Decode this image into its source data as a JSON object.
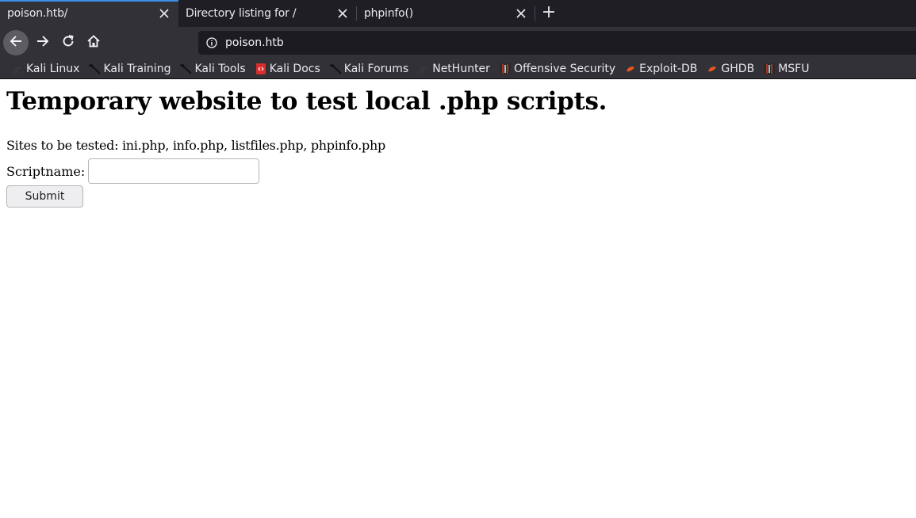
{
  "browser": {
    "tabs": [
      {
        "title": "poison.htb/",
        "active": true
      },
      {
        "title": "Directory listing for /",
        "active": false
      },
      {
        "title": "phpinfo()",
        "active": false
      }
    ],
    "url": "poison.htb",
    "bookmarks": [
      {
        "label": "Kali Linux",
        "icon": "kali-dragon-icon"
      },
      {
        "label": "Kali Training",
        "icon": "kali-dragon-icon"
      },
      {
        "label": "Kali Tools",
        "icon": "kali-dragon-icon"
      },
      {
        "label": "Kali Docs",
        "icon": "kali-docs-icon"
      },
      {
        "label": "Kali Forums",
        "icon": "kali-dragon-icon"
      },
      {
        "label": "NetHunter",
        "icon": "nethunter-icon"
      },
      {
        "label": "Offensive Security",
        "icon": "offsec-icon"
      },
      {
        "label": "Exploit-DB",
        "icon": "exploit-db-icon"
      },
      {
        "label": "GHDB",
        "icon": "ghdb-icon"
      },
      {
        "label": "MSFU",
        "icon": "offsec-icon"
      }
    ],
    "colors": {
      "tabstrip": "#1f1e25",
      "toolbar": "#323138",
      "urlbar": "#1c1b22",
      "active_tab_accent": "#3e8ee8"
    }
  },
  "page": {
    "heading": "Temporary website to test local .php scripts.",
    "sites_text": "Sites to be tested: ini.php, info.php, listfiles.php, phpinfo.php",
    "script_label": "Scriptname:",
    "script_value": "",
    "submit_label": "Submit"
  }
}
